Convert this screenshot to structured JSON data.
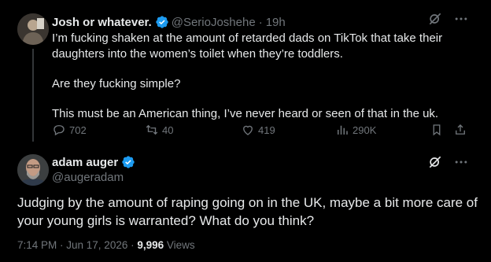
{
  "colors": {
    "background": "#000000",
    "text": "#e7e9ea",
    "muted": "#71767b",
    "verified": "#1d9bf0"
  },
  "post1": {
    "name": "Josh or whatever.",
    "handle": "@SerioJoshehe",
    "separator": "·",
    "time": "19h",
    "paragraphs": [
      "I’m fucking shaken at the amount of retarded dads on TikTok that take their daughters into the women’s toilet when they’re toddlers.",
      "Are they fucking simple?",
      "This must be an American thing, I’ve never heard or seen of that in the uk."
    ],
    "actions": {
      "replies": "702",
      "reposts": "40",
      "likes": "419",
      "views": "290K"
    },
    "icons": [
      "grok-icon",
      "more-icon",
      "reply-icon",
      "repost-icon",
      "like-icon",
      "views-icon",
      "bookmark-icon",
      "share-icon"
    ]
  },
  "post2": {
    "name": "adam auger",
    "handle": "@augeradam",
    "text": "Judging by the amount of raping going on in the UK, maybe a bit more care of your young girls is warranted? What do you think?",
    "timestamp": "7:14 PM · Jun 17, 2026 · ",
    "views_count": "9,996",
    "views_label": "Views",
    "icons": [
      "grok-icon",
      "more-icon"
    ]
  }
}
